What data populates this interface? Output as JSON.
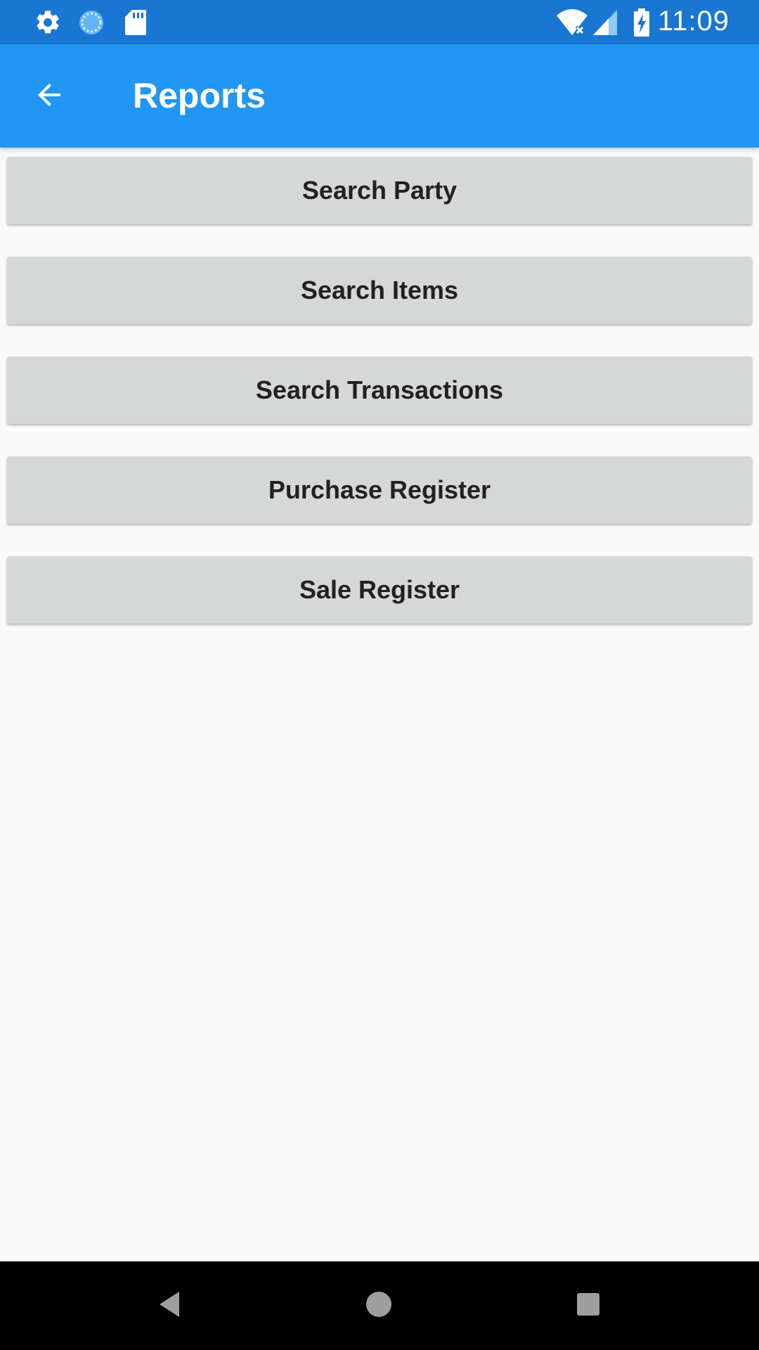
{
  "status_bar": {
    "time": "11:09",
    "icons": [
      "settings-icon",
      "sync-icon",
      "sd-card-icon",
      "wifi-icon",
      "signal-icon",
      "battery-charging-icon"
    ]
  },
  "app_bar": {
    "back_icon": "arrow-back-icon",
    "title": "Reports"
  },
  "buttons": [
    {
      "label": "Search Party"
    },
    {
      "label": "Search Items"
    },
    {
      "label": "Search Transactions"
    },
    {
      "label": "Purchase Register"
    },
    {
      "label": "Sale Register"
    }
  ],
  "nav_bar": {
    "icons": [
      "back-triangle-icon",
      "home-circle-icon",
      "recents-square-icon"
    ]
  },
  "colors": {
    "status_bar": "#1976d2",
    "app_bar": "#2196f3",
    "button_bg": "#d6d7d7",
    "background": "#fafafa"
  }
}
